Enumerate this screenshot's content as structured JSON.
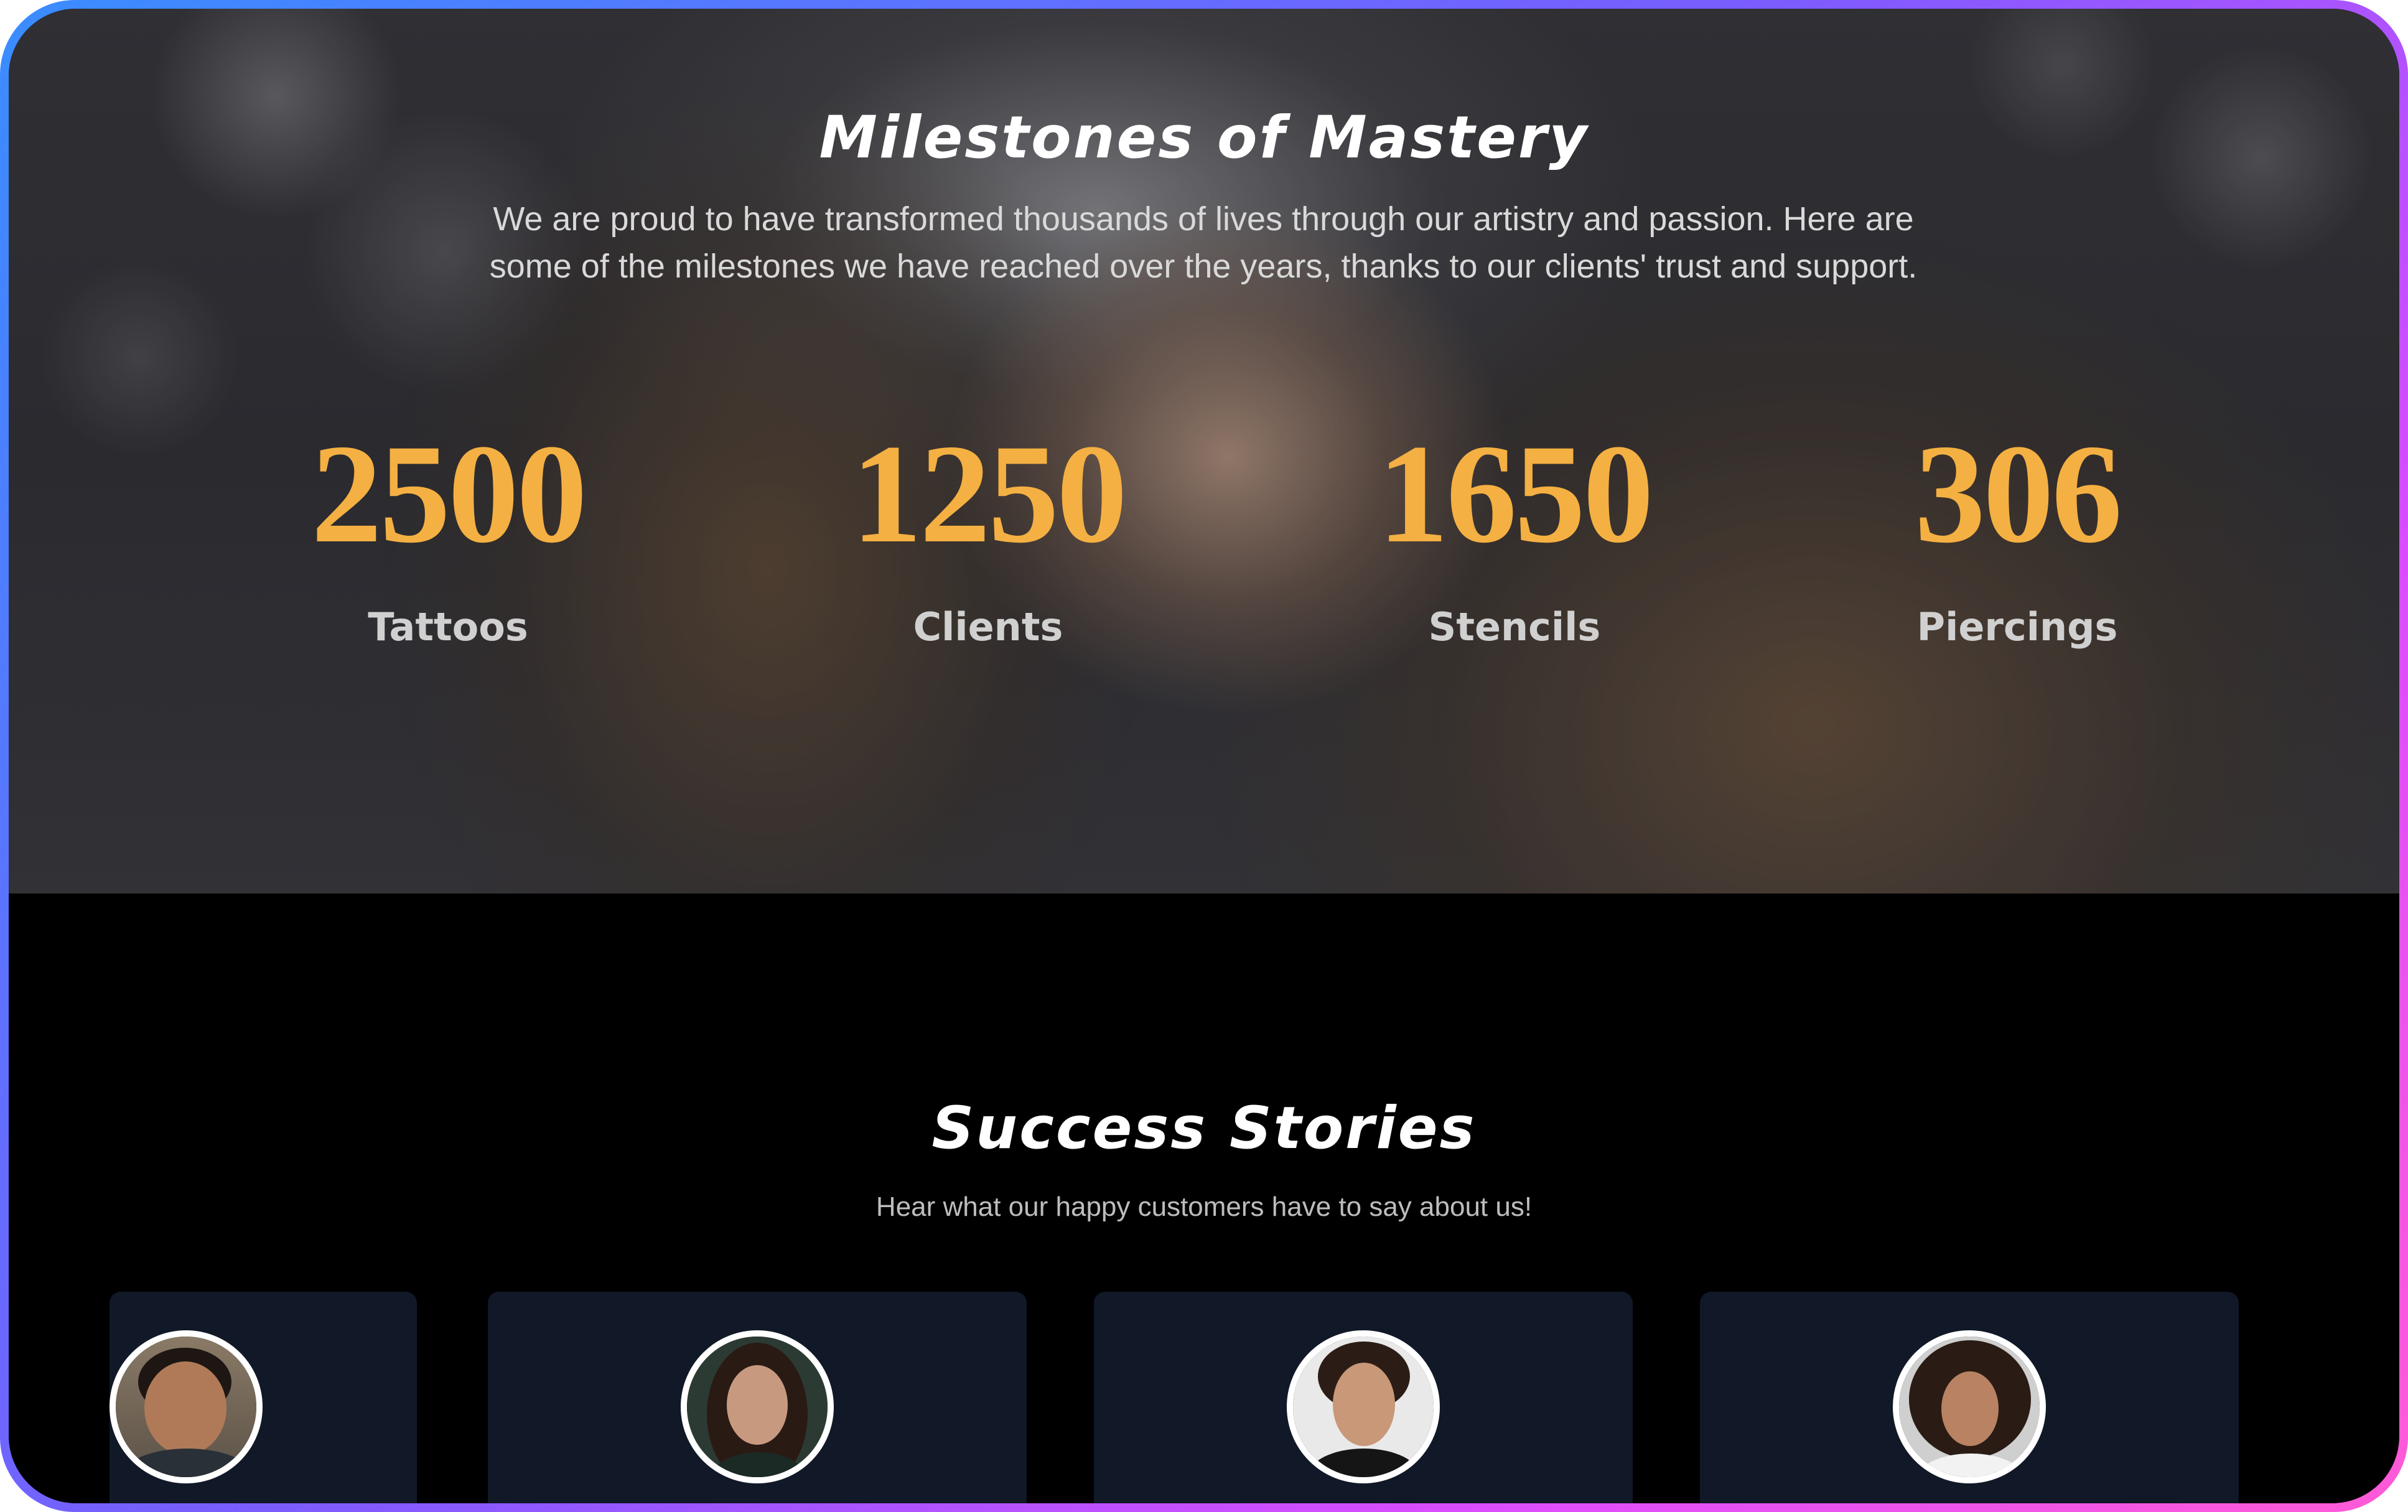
{
  "milestones": {
    "title": "Milestones of Mastery",
    "description_line1": "We are proud to have transformed thousands of lives through our artistry and passion. Here are",
    "description_line2": "some of the milestones we have reached over the years, thanks to our clients' trust and support.",
    "stats": [
      {
        "value": "2500",
        "label": "Tattoos"
      },
      {
        "value": "1250",
        "label": "Clients"
      },
      {
        "value": "1650",
        "label": "Stencils"
      },
      {
        "value": "306",
        "label": "Piercings"
      }
    ],
    "accent_color": "#f4b042"
  },
  "stories": {
    "title": "Success Stories",
    "subtitle": "Hear what our happy customers have to say about us!",
    "cards": [
      {
        "avatar": "smiling-man-avatar"
      },
      {
        "avatar": "dark-haired-woman-avatar"
      },
      {
        "avatar": "young-man-curly-hair-avatar"
      },
      {
        "avatar": "curly-haired-woman-avatar"
      }
    ],
    "card_color": "#111827"
  },
  "frame": {
    "gradient_colors": [
      "#3a8dff",
      "#7a5cff",
      "#d94cff",
      "#ff5bd6"
    ]
  }
}
